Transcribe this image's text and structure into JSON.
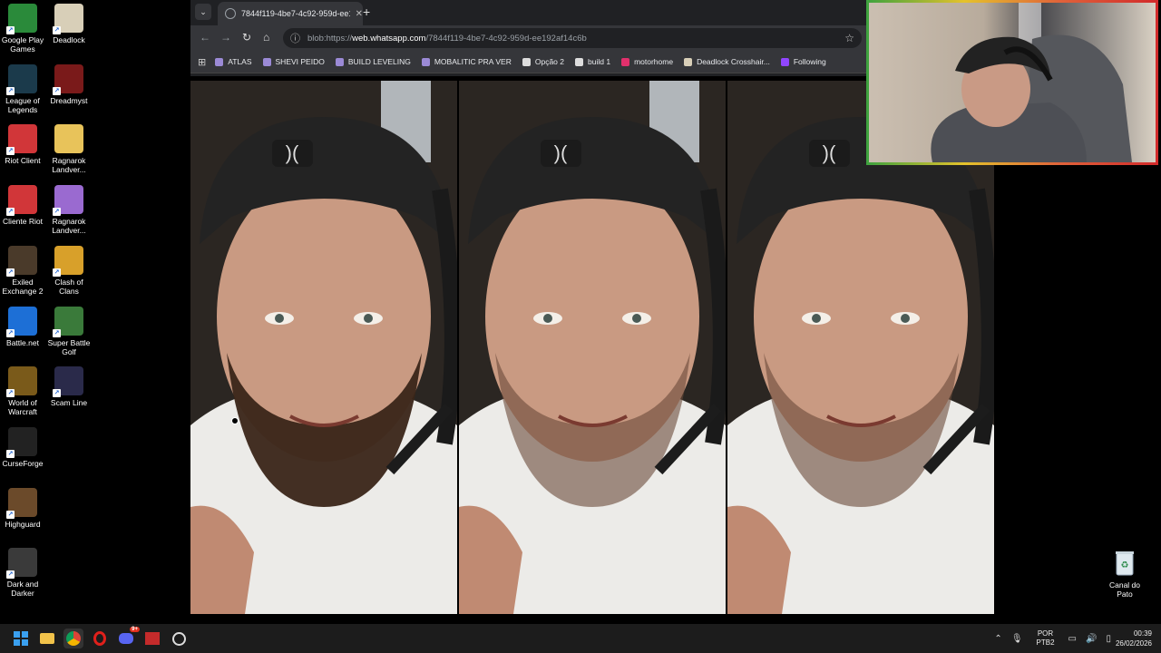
{
  "desktop": {
    "icons_left": [
      {
        "label": "Google Play Games",
        "icon": "google-play-games-icon",
        "color": "#2a8a3a"
      },
      {
        "label": "League of Legends",
        "icon": "league-of-legends-icon",
        "color": "#1b3a4b"
      },
      {
        "label": "Riot Client",
        "icon": "riot-client-icon",
        "color": "#d13639"
      },
      {
        "label": "Cliente Riot",
        "icon": "riot-client-icon",
        "color": "#d13639"
      },
      {
        "label": "Exiled Exchange 2",
        "icon": "exiled-exchange-icon",
        "color": "#4a3a2a"
      },
      {
        "label": "Battle.net",
        "icon": "battlenet-icon",
        "color": "#1d6fd6"
      },
      {
        "label": "World of Warcraft",
        "icon": "world-of-warcraft-icon",
        "color": "#7a5a1a"
      },
      {
        "label": "CurseForge",
        "icon": "curseforge-icon",
        "color": "#222222"
      },
      {
        "label": "Highguard",
        "icon": "highguard-icon",
        "color": "#6b4a2a"
      },
      {
        "label": "Dark and Darker",
        "icon": "dark-and-darker-icon",
        "color": "#3a3a3a"
      }
    ],
    "icons_right": [
      {
        "label": "Deadlock",
        "icon": "deadlock-icon",
        "color": "#d8cfb8"
      },
      {
        "label": "Dreadmyst",
        "icon": "dreadmyst-icon",
        "color": "#7a1a1a"
      },
      {
        "label": "Ragnarok Landver...",
        "icon": "folder-icon",
        "color": "#e8c35a"
      },
      {
        "label": "Ragnarok Landver...",
        "icon": "ragnarok-icon",
        "color": "#9a6ad0"
      },
      {
        "label": "Clash of Clans",
        "icon": "clash-of-clans-icon",
        "color": "#d8a02a"
      },
      {
        "label": "Super Battle Golf",
        "icon": "super-battle-golf-icon",
        "color": "#3a7a3a"
      },
      {
        "label": "Scam Line",
        "icon": "scam-line-icon",
        "color": "#2a2a4a"
      }
    ],
    "recycle_bin": {
      "label": "Canal do Pato",
      "icon": "recycle-bin-icon"
    }
  },
  "browser": {
    "tab_title": "7844f119-4be7-4c92-959d-ee1",
    "url_prefix": "blob:https://",
    "url_host": "web.whatsapp.com",
    "url_rest": "/7844f119-4be7-4c92-959d-ee192af14c6b",
    "bookmarks": [
      {
        "label": "ATLAS",
        "icon": "twitch-icon",
        "color": "#9b8ad6"
      },
      {
        "label": "SHEVI PEIDO",
        "icon": "twitch-icon",
        "color": "#9b8ad6"
      },
      {
        "label": "BUILD LEVELING",
        "icon": "twitch-icon",
        "color": "#9b8ad6"
      },
      {
        "label": "MOBALITIC PRA VER",
        "icon": "twitch-icon",
        "color": "#9b8ad6"
      },
      {
        "label": "Opção 2",
        "icon": "mobalytics-icon",
        "color": "#dddddd"
      },
      {
        "label": "build 1",
        "icon": "mobalytics-icon",
        "color": "#dddddd"
      },
      {
        "label": "motorhome",
        "icon": "instagram-icon",
        "color": "#e1306c"
      },
      {
        "label": "Deadlock Crosshair...",
        "icon": "deadlock-icon",
        "color": "#d8cfb8"
      },
      {
        "label": "Following",
        "icon": "twitch-icon",
        "color": "#9146ff"
      }
    ]
  },
  "taskbar": {
    "language": "POR",
    "layout": "PTB2",
    "time": "00:39",
    "date": "26/02/2026",
    "discord_badge": "9+"
  }
}
